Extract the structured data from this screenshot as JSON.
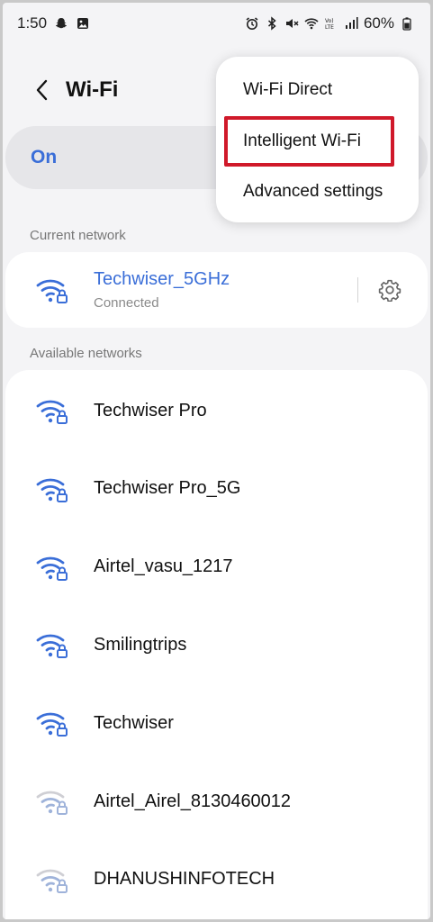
{
  "status_bar": {
    "time": "1:50",
    "battery": "60%",
    "left_icons": [
      "snapchat-icon",
      "gallery-icon"
    ],
    "right_icons": [
      "alarm-icon",
      "bluetooth-icon",
      "mute-icon",
      "wifi-icon",
      "volte-icon",
      "signal-icon",
      "battery-icon"
    ]
  },
  "header": {
    "title": "Wi-Fi"
  },
  "toggle": {
    "label": "On"
  },
  "current_section": {
    "label": "Current network",
    "network": {
      "name": "Techwiser_5GHz",
      "status": "Connected"
    }
  },
  "available_section": {
    "label": "Available networks",
    "networks": [
      {
        "name": "Techwiser Pro",
        "strength": "full"
      },
      {
        "name": "Techwiser Pro_5G",
        "strength": "full"
      },
      {
        "name": "Airtel_vasu_1217",
        "strength": "full"
      },
      {
        "name": "Smilingtrips",
        "strength": "full"
      },
      {
        "name": "Techwiser",
        "strength": "full"
      },
      {
        "name": "Airtel_Airel_8130460012",
        "strength": "weak"
      },
      {
        "name": "DHANUSHINFOTECH",
        "strength": "weak"
      }
    ]
  },
  "menu": {
    "items": [
      "Wi-Fi Direct",
      "Intelligent Wi-Fi",
      "Advanced settings"
    ],
    "highlighted_index": 1
  },
  "colors": {
    "accent": "#3a6ed8",
    "highlight": "#d0192a",
    "background": "#f4f4f6",
    "card": "#ffffff"
  }
}
